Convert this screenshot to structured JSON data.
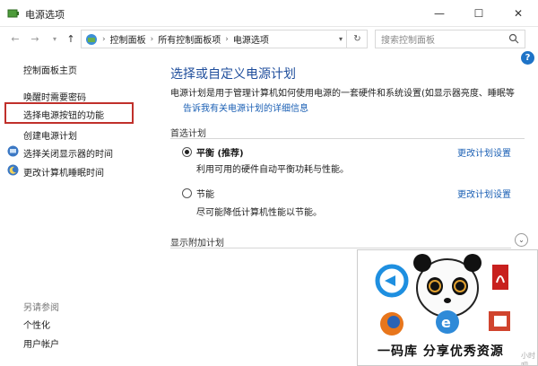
{
  "window": {
    "title": "电源选项",
    "controls": {
      "minimize": "—",
      "maximize": "☐",
      "close": "✕"
    }
  },
  "navigation": {
    "breadcrumbs": [
      "控制面板",
      "所有控制面板项",
      "电源选项"
    ],
    "search_placeholder": "搜索控制面板"
  },
  "sidebar": {
    "home": "控制面板主页",
    "links": [
      {
        "label": "唤醒时需要密码",
        "icon": ""
      },
      {
        "label": "选择电源按钮的功能",
        "icon": "",
        "highlighted": true
      },
      {
        "label": "创建电源计划",
        "icon": ""
      },
      {
        "label": "选择关闭显示器的时间",
        "icon": "monitor-icon"
      },
      {
        "label": "更改计算机睡眠时间",
        "icon": "moon-icon"
      }
    ],
    "see_also": {
      "heading": "另请参阅",
      "links": [
        "个性化",
        "用户帐户"
      ]
    }
  },
  "main": {
    "title": "选择或自定义电源计划",
    "description": "电源计划是用于管理计算机如何使用电源的一套硬件和系统设置(如显示器亮度、睡眠等",
    "description_link": "告诉我有关电源计划的详细信息",
    "preferred_heading": "首选计划",
    "plans": [
      {
        "name": "平衡 (推荐)",
        "desc": "利用可用的硬件自动平衡功耗与性能。",
        "selected": true,
        "change_link": "更改计划设置"
      },
      {
        "name": "节能",
        "desc": "尽可能降低计算机性能以节能。",
        "selected": false,
        "change_link": "更改计划设置"
      }
    ],
    "extra_heading": "显示附加计划"
  },
  "watermark": {
    "text": "一码库  分享优秀资源",
    "small": "小时吧"
  },
  "colors": {
    "accent": "#1f4e9c",
    "link": "#1a5fb4",
    "highlight_box": "#c0302b",
    "help": "#1e73c7"
  }
}
